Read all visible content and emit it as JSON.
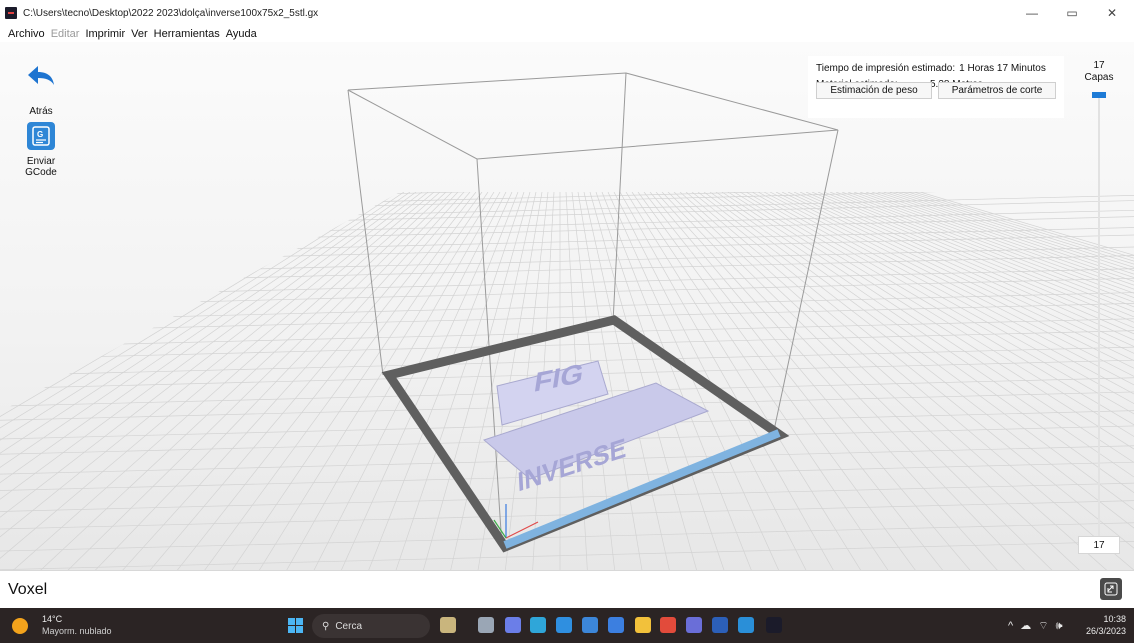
{
  "window": {
    "title": "C:\\Users\\tecno\\Desktop\\2022 2023\\dolça\\inverse100x75x2_5stl.gx",
    "minimize_glyph": "—",
    "maximize_glyph": "▭",
    "close_glyph": "✕"
  },
  "menu": {
    "items": [
      "Archivo",
      "Editar",
      "Imprimir",
      "Ver",
      "Herramientas",
      "Ayuda"
    ],
    "disabled": [
      "Editar"
    ]
  },
  "tools": {
    "back_label": "Atrás",
    "back_icon": "back-arrow-icon",
    "send_label_line1": "Enviar",
    "send_label_line2": "GCode",
    "send_icon": "gcode-icon",
    "send_icon_glyph": "G"
  },
  "info": {
    "time_label": "Tiempo de impresión estimado:",
    "time_value": "1 Horas 17 Minutos",
    "material_label": "Material estimado:",
    "material_value": "5.38 Metros",
    "weight_button": "Estimación de peso",
    "params_button": "Parámetros de corte"
  },
  "layers": {
    "top_value": "17",
    "label": "Capas",
    "current_value": "17"
  },
  "model": {
    "text_top": "FIG",
    "text_main": "INVERSE",
    "color": "#c9c9ea"
  },
  "status": {
    "text": "Voxel",
    "icon": "link-icon"
  },
  "taskbar": {
    "weather_temp": "14°C",
    "weather_desc": "Mayorm. nublado",
    "search_placeholder": "Cerca",
    "tray_glyphs": "^ ☁ ⌔ 🕪",
    "time": "10:38",
    "date": "26/3/2023",
    "apps": [
      {
        "name": "widgets-icon",
        "color": "#c9b57d"
      },
      {
        "name": "task-view-icon",
        "color": "#9aa6b5"
      },
      {
        "name": "meet-icon",
        "color": "#6b7ee8"
      },
      {
        "name": "edge-icon",
        "color": "#2fa6d9"
      },
      {
        "name": "mail-icon",
        "color": "#2f8fe0"
      },
      {
        "name": "store-icon",
        "color": "#3c86d9"
      },
      {
        "name": "calendar-icon",
        "color": "#3c7fe0"
      },
      {
        "name": "explorer-icon",
        "color": "#f2c13b"
      },
      {
        "name": "chrome-icon",
        "color": "#e24b3b"
      },
      {
        "name": "teams-icon",
        "color": "#6a6ed8"
      },
      {
        "name": "word-icon",
        "color": "#2c5fb8"
      },
      {
        "name": "app-icon",
        "color": "#2a8fd8"
      },
      {
        "name": "flashprint-icon",
        "color": "#1b1b2a"
      }
    ]
  }
}
